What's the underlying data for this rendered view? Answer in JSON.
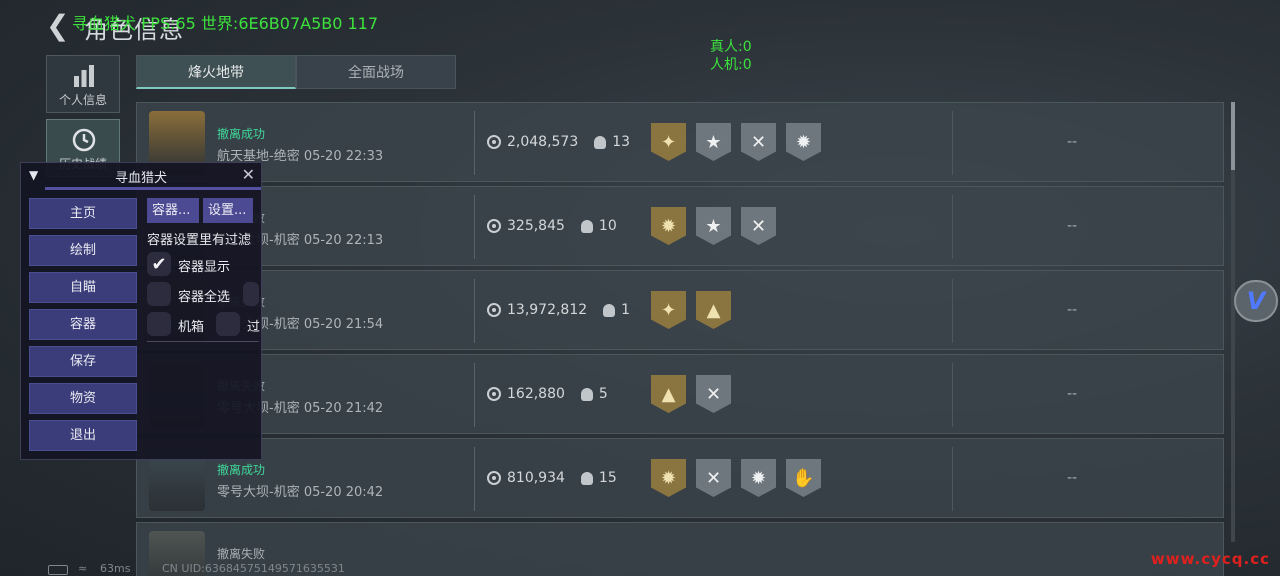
{
  "header": {
    "title": "角色信息",
    "overlay_text": "寻血猎犬  FPS:65 世界:6E6B07A5B0 117",
    "real_players": "真人:0",
    "bots": "人机:0"
  },
  "tabs": [
    {
      "label": "烽火地带",
      "active": true
    },
    {
      "label": "全面战场",
      "active": false
    }
  ],
  "left_nav": [
    {
      "label": "个人信息",
      "icon": "bar-chart-icon"
    },
    {
      "label": "历史战绩",
      "icon": "history-clock-icon"
    }
  ],
  "records": [
    {
      "status": "撤离成功",
      "map_time": "航天基地-绝密 05-20 22:33",
      "money": "2,048,573",
      "kills": "13",
      "result": "--",
      "status_type": "ok",
      "badges": [
        {
          "icon": "squad-emblem-icon",
          "tone": "gold"
        },
        {
          "icon": "star-check-icon",
          "tone": "gray"
        },
        {
          "icon": "crossed-arrows-icon",
          "tone": "gray"
        },
        {
          "icon": "burst-icon",
          "tone": "gray"
        }
      ]
    },
    {
      "status": "撤离失败",
      "map_time": "零号大坝-机密 05-20 22:13",
      "money": "325,845",
      "kills": "10",
      "result": "--",
      "status_type": "fail",
      "badges": [
        {
          "icon": "burst-icon",
          "tone": "gold"
        },
        {
          "icon": "star-check-icon",
          "tone": "gray"
        },
        {
          "icon": "crossed-arrows-icon",
          "tone": "gray"
        }
      ]
    },
    {
      "status": "撤离失败",
      "map_time": "零号大坝-机密 05-20 21:54",
      "money": "13,972,812",
      "kills": "1",
      "result": "--",
      "status_type": "fail",
      "badges": [
        {
          "icon": "squad-emblem-icon",
          "tone": "gold"
        },
        {
          "icon": "helmet-icon",
          "tone": "gold"
        }
      ]
    },
    {
      "status": "撤离失败",
      "map_time": "零号大坝-机密 05-20 21:42",
      "money": "162,880",
      "kills": "5",
      "result": "--",
      "status_type": "fail",
      "badges": [
        {
          "icon": "helmet-icon",
          "tone": "gold"
        },
        {
          "icon": "crossed-arrows-icon",
          "tone": "gray"
        }
      ]
    },
    {
      "status": "撤离成功",
      "map_time": "零号大坝-机密 05-20 20:42",
      "money": "810,934",
      "kills": "15",
      "result": "--",
      "status_type": "ok",
      "badges": [
        {
          "icon": "burst-icon",
          "tone": "gold"
        },
        {
          "icon": "crossed-arrows-icon",
          "tone": "gray"
        },
        {
          "icon": "burst-icon",
          "tone": "gray"
        },
        {
          "icon": "handshake-icon",
          "tone": "gray"
        }
      ]
    },
    {
      "status": "撤离失败",
      "map_time": "",
      "money": "",
      "kills": "",
      "result": "",
      "status_type": "fail",
      "badges": []
    }
  ],
  "cheat_panel": {
    "title": "寻血猎犬",
    "menu": [
      "主页",
      "绘制",
      "自瞄",
      "容器",
      "保存",
      "物资",
      "退出"
    ],
    "sub_tabs": [
      "容器...",
      "设置..."
    ],
    "note": "容器设置里有过滤",
    "checkboxes": [
      {
        "label": "容器显示",
        "checked": true
      },
      {
        "label": "容器全选",
        "checked": false
      },
      {
        "label": "机箱",
        "checked": false
      }
    ],
    "extra_checkbox_labels": [
      "",
      "过"
    ]
  },
  "footer": {
    "ping": "63ms",
    "uid": "CN UID:6368457514957163553​1",
    "watermark": "www.cycq.cc"
  },
  "colors": {
    "success_green": "#3fd79a",
    "overlay_green": "#3de23d",
    "badge_gold": "#8a7540",
    "panel_button": "#3a3d7a",
    "watermark_red": "#e0201d"
  }
}
